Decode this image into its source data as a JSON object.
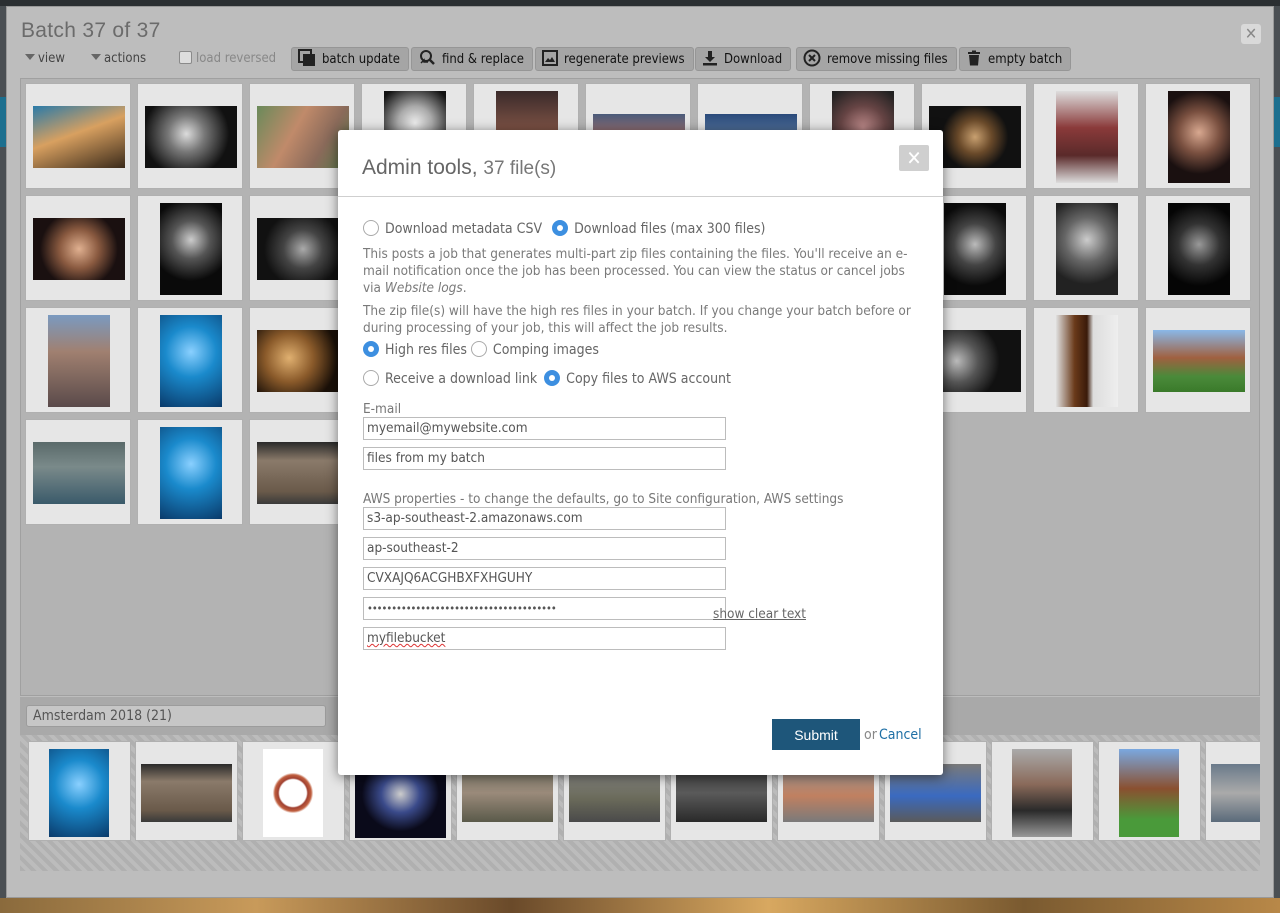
{
  "batch": {
    "title": "Batch 37 of 37"
  },
  "toolbar": {
    "view_label": "view",
    "actions_label": "actions",
    "load_reversed_label": "load reversed",
    "buttons": [
      {
        "label": "batch update",
        "icon": "copy-icon"
      },
      {
        "label": "find & replace",
        "icon": "search-replace-icon"
      },
      {
        "label": "regenerate previews",
        "icon": "image-icon"
      },
      {
        "label": "Download",
        "icon": "download-icon"
      },
      {
        "label": "remove missing files",
        "icon": "remove-circle-icon"
      },
      {
        "label": "empty batch",
        "icon": "trash-icon"
      }
    ]
  },
  "album": {
    "selected": "Amsterdam 2018 (21)"
  },
  "modal": {
    "title": "Admin tools,",
    "file_count": "37 file(s)",
    "option_metadata": "Download metadata CSV",
    "option_files": "Download files (max 300 files)",
    "para1": "This posts a job that generates multi-part zip files containing the files. You'll receive an e-mail notification once the job has been processed. You can view the status or cancel jobs via",
    "para1_link": "Website logs",
    "para1_end": ".",
    "para2": "The zip file(s) will have the high res files in your batch. If you change your batch before or during processing of your job, this will affect the job results.",
    "option_highres": "High res files",
    "option_comping": "Comping images",
    "option_link": "Receive a download link",
    "option_aws": "Copy files to AWS account",
    "email_label": "E-mail",
    "email_value": "myemail@mywebsite.com",
    "subject_value": "files from my batch",
    "aws_label": "AWS properties - to change the defaults, go to Site configuration, AWS settings",
    "aws_endpoint": "s3-ap-southeast-2.amazonaws.com",
    "aws_region": "ap-southeast-2",
    "aws_key": "CVXAJQ6ACGHBXFXHGUHY",
    "aws_secret": "•••••••••••••••••••••••••••••••••••••••",
    "aws_bucket": "myfilebucket",
    "show_clear_text": "show clear text",
    "submit_label": "Submit",
    "or_text": "or",
    "cancel_label": "Cancel"
  },
  "colors": {
    "primary_button": "#1e567a",
    "radio_selected": "#3d8fe0",
    "link": "#1e6fa5",
    "overlay": "#4a4f53"
  }
}
